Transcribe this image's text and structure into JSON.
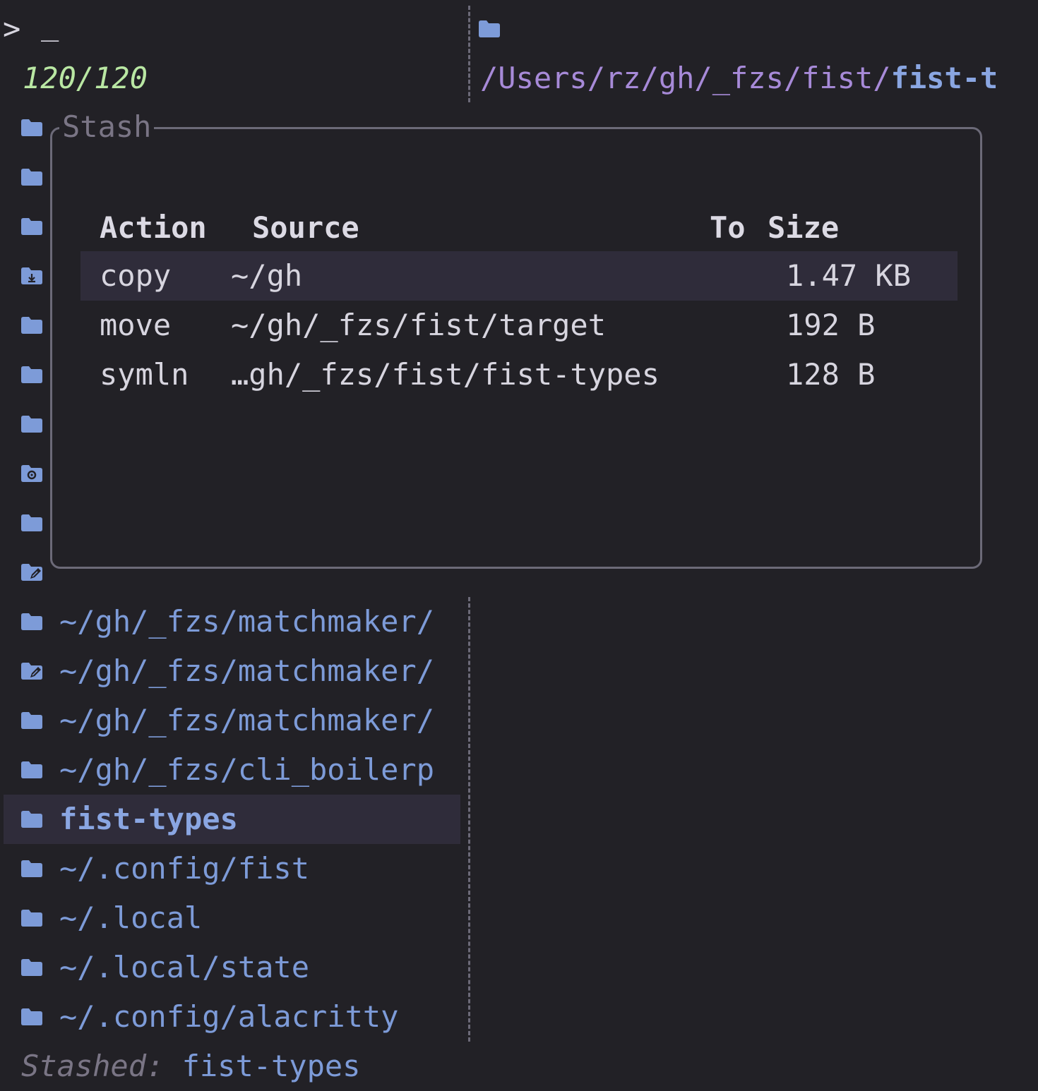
{
  "prompt": {
    "symbol": ">",
    "cursor": "_"
  },
  "match_count": "120/120",
  "preview": {
    "path_prefix": "/Users/rz/gh/_fzs/fist/",
    "path_highlight": "fist-t"
  },
  "list": {
    "items": [
      {
        "icon": "folder-icon",
        "label": ""
      },
      {
        "icon": "folder-icon",
        "label": ""
      },
      {
        "icon": "folder-icon",
        "label": ""
      },
      {
        "icon": "folder-download-icon",
        "label": ""
      },
      {
        "icon": "folder-icon",
        "label": ""
      },
      {
        "icon": "folder-icon",
        "label": ""
      },
      {
        "icon": "folder-icon",
        "label": ""
      },
      {
        "icon": "folder-gear-icon",
        "label": ""
      },
      {
        "icon": "folder-icon",
        "label": ""
      },
      {
        "icon": "folder-edit-icon",
        "label": ""
      },
      {
        "icon": "folder-icon",
        "label": "~/gh/_fzs/matchmaker/"
      },
      {
        "icon": "folder-edit-icon",
        "label": "~/gh/_fzs/matchmaker/"
      },
      {
        "icon": "folder-icon",
        "label": "~/gh/_fzs/matchmaker/"
      },
      {
        "icon": "folder-icon",
        "label": "~/gh/_fzs/cli_boilerp"
      },
      {
        "icon": "folder-icon",
        "label": "fist-types",
        "selected": true
      },
      {
        "icon": "folder-icon",
        "label": "~/.config/fist"
      },
      {
        "icon": "folder-icon",
        "label": "~/.local"
      },
      {
        "icon": "folder-icon",
        "label": "~/.local/state"
      },
      {
        "icon": "folder-icon",
        "label": "~/.config/alacritty"
      }
    ]
  },
  "stash": {
    "title": "Stash",
    "headers": {
      "action": "Action",
      "source": "Source",
      "to": "To",
      "size": "Size"
    },
    "rows": [
      {
        "action": "copy",
        "source": "~/gh",
        "to": "",
        "size": "1.47 KB",
        "selected": true
      },
      {
        "action": "move",
        "source": "~/gh/_fzs/fist/target",
        "to": "",
        "size": "192 B"
      },
      {
        "action": "symln",
        "source": "…gh/_fzs/fist/fist-types",
        "to": "",
        "size": "128 B"
      }
    ]
  },
  "footer": {
    "label": "Stashed:",
    "value": "fist-types"
  },
  "colors": {
    "background": "#222126",
    "accent_blue": "#7d9bd8",
    "count_green": "#b9e7a3",
    "path_purple": "#a78ad8",
    "selection": "#2f2c3a",
    "border": "#6c6a78"
  }
}
